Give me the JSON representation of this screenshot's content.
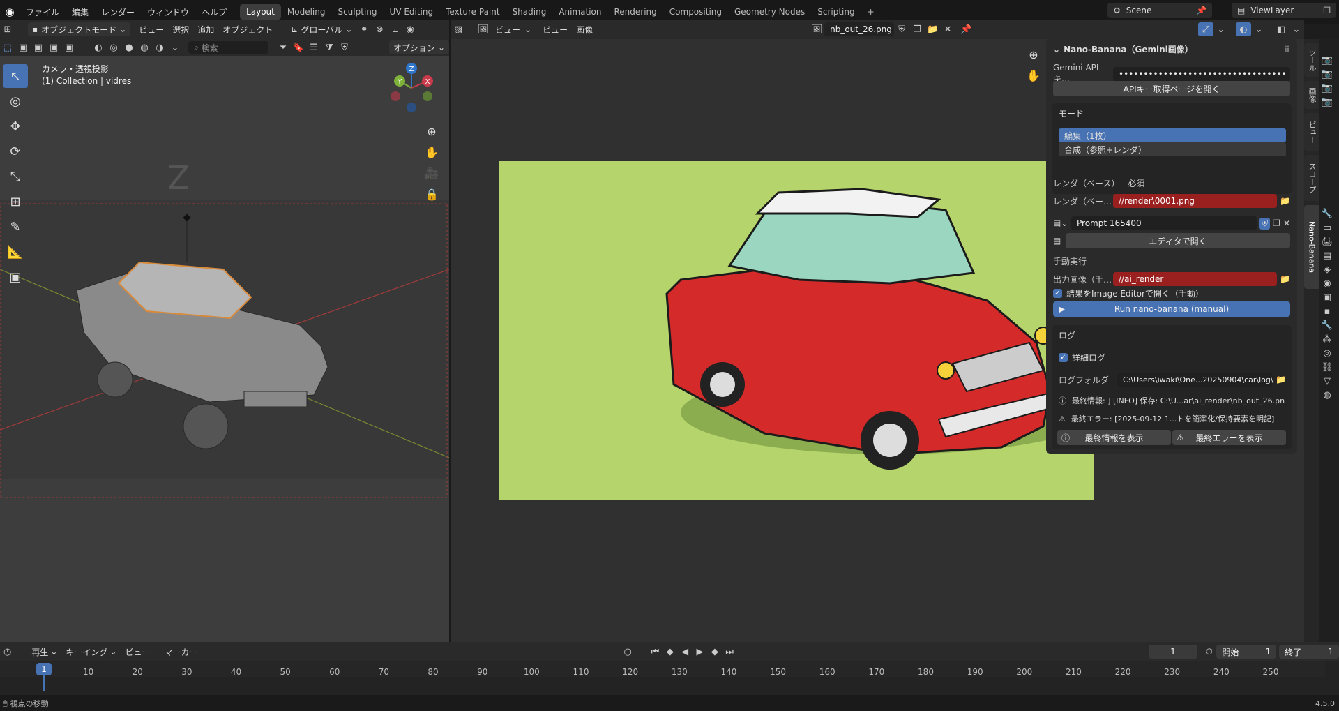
{
  "topbar": {
    "menus": [
      "ファイル",
      "編集",
      "レンダー",
      "ウィンドウ",
      "ヘルプ"
    ],
    "workspaces": [
      "Layout",
      "Modeling",
      "Sculpting",
      "UV Editing",
      "Texture Paint",
      "Shading",
      "Animation",
      "Rendering",
      "Compositing",
      "Geometry Nodes",
      "Scripting"
    ],
    "active_workspace": "Layout",
    "add_tab": "+",
    "scene": "Scene",
    "view_layer": "ViewLayer"
  },
  "viewport3d": {
    "mode": "オブジェクトモード",
    "menus": [
      "ビュー",
      "選択",
      "追加",
      "オブジェクト"
    ],
    "transform": "グローバル",
    "search_placeholder": "検索",
    "options": "オプション",
    "view_name": "カメラ・透視投影",
    "collection": "(1) Collection | vidres",
    "gizmo": {
      "z": "Z",
      "y": "Y",
      "x": "X"
    }
  },
  "image_editor": {
    "menus": [
      "ビュー",
      "ビュー",
      "画像"
    ],
    "image_name": "nb_out_26.png",
    "bg_color": "#b5d46b"
  },
  "nano_panel": {
    "title": "Nano-Banana（Gemini画像）",
    "api_label": "Gemini APIキ…",
    "api_value": "••••••••••••••••••••••••••••••••••",
    "api_button": "APIキー取得ページを開く",
    "mode_label": "モード",
    "mode_options": [
      "編集（1枚）",
      "合成（参照+レンダ）"
    ],
    "render_base_header": "レンダ（ベース） - 必須",
    "render_base_label": "レンダ（ベー…",
    "render_base_value": "//render\\0001.png",
    "prompt_name": "Prompt 165400",
    "open_editor": "エディタで開く",
    "manual_header": "手動実行",
    "output_label": "出力画像（手…",
    "output_value": "//ai_render",
    "open_result_label": "結果をImage Editorで開く（手動）",
    "run_button": "Run nano-banana (manual)",
    "log_header": "ログ",
    "verbose_label": "詳細ログ",
    "log_folder_label": "ログフォルダ",
    "log_folder_value": "C:\\Users\\iwaki\\One...20250904\\car\\log\\",
    "last_info": "最終情報: ] [INFO] 保存: C:\\U...ar\\ai_render\\nb_out_26.png",
    "last_error": "最終エラー: [2025-09-12 1...トを簡潔化/保持要素を明記]",
    "show_info": "最終情報を表示",
    "show_error": "最終エラーを表示"
  },
  "side_tabs": [
    "ツール",
    "画像",
    "ビュー",
    "スコープ",
    "Nano-Banana"
  ],
  "timeline": {
    "menus": [
      "再生",
      "キーイング",
      "ビュー",
      "マーカー"
    ],
    "current_frame": "1",
    "start_label": "開始",
    "start_value": "1",
    "end_label": "終了",
    "end_value": "1",
    "ticks": [
      "1",
      "10",
      "20",
      "30",
      "40",
      "50",
      "60",
      "70",
      "80",
      "90",
      "100",
      "110",
      "120",
      "130",
      "140",
      "150",
      "160",
      "170",
      "180",
      "190",
      "200",
      "210",
      "220",
      "230",
      "240",
      "250"
    ]
  },
  "statusbar": {
    "hint": "視点の移動",
    "version": "4.5.0"
  }
}
